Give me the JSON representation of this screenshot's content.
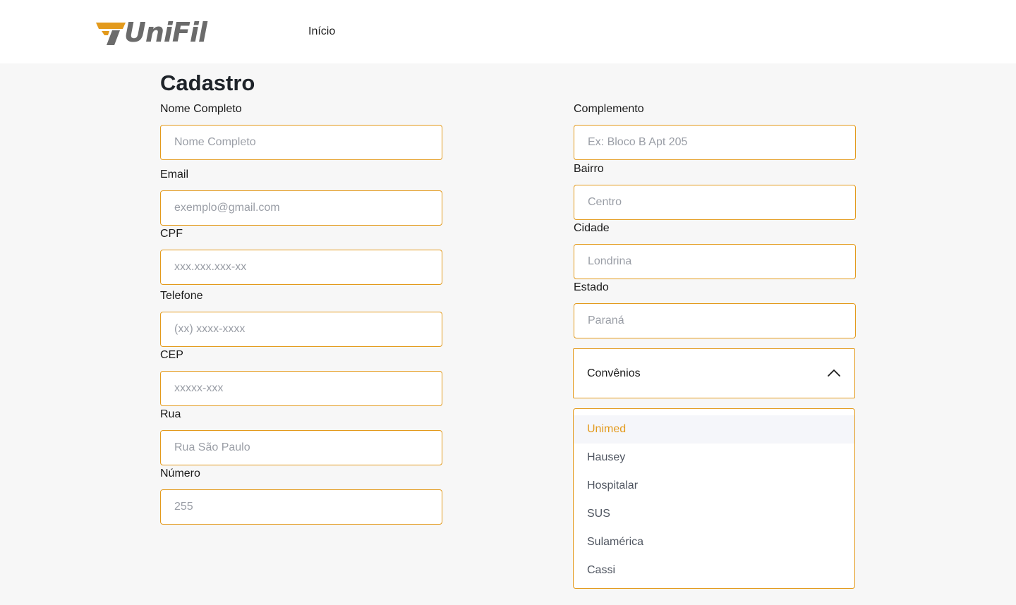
{
  "header": {
    "logo_text": "UniFil",
    "nav_home": "Início"
  },
  "page": {
    "title": "Cadastro"
  },
  "form": {
    "left": [
      {
        "label": "Nome Completo",
        "placeholder": "Nome Completo",
        "value": ""
      },
      {
        "label": "Email",
        "placeholder": "exemplo@gmail.com",
        "value": ""
      },
      {
        "label": "CPF",
        "placeholder": "xxx.xxx.xxx-xx",
        "value": ""
      },
      {
        "label": "Telefone",
        "placeholder": "(xx) xxxx-xxxx",
        "value": ""
      },
      {
        "label": "CEP",
        "placeholder": "xxxxx-xxx",
        "value": ""
      },
      {
        "label": "Rua",
        "placeholder": "Rua São Paulo",
        "value": ""
      },
      {
        "label": "Número",
        "placeholder": "255",
        "value": ""
      }
    ],
    "right": [
      {
        "label": "Complemento",
        "placeholder": "Ex: Bloco B Apt 205",
        "value": ""
      },
      {
        "label": "Bairro",
        "placeholder": "Centro",
        "value": ""
      },
      {
        "label": "Cidade",
        "placeholder": "Londrina",
        "value": ""
      },
      {
        "label": "Estado",
        "placeholder": "Paraná",
        "value": ""
      }
    ]
  },
  "convenios": {
    "label": "Convênios",
    "expanded": true,
    "highlighted_index": 0,
    "options": [
      "Unimed",
      "Hausey",
      "Hospitalar",
      "SUS",
      "Sulamérica",
      "Cassi"
    ]
  },
  "colors": {
    "accent": "#e39a1c",
    "logo_gray": "#6b6b6b",
    "page_background": "#f7f7f7",
    "header_background": "#ffffff"
  }
}
